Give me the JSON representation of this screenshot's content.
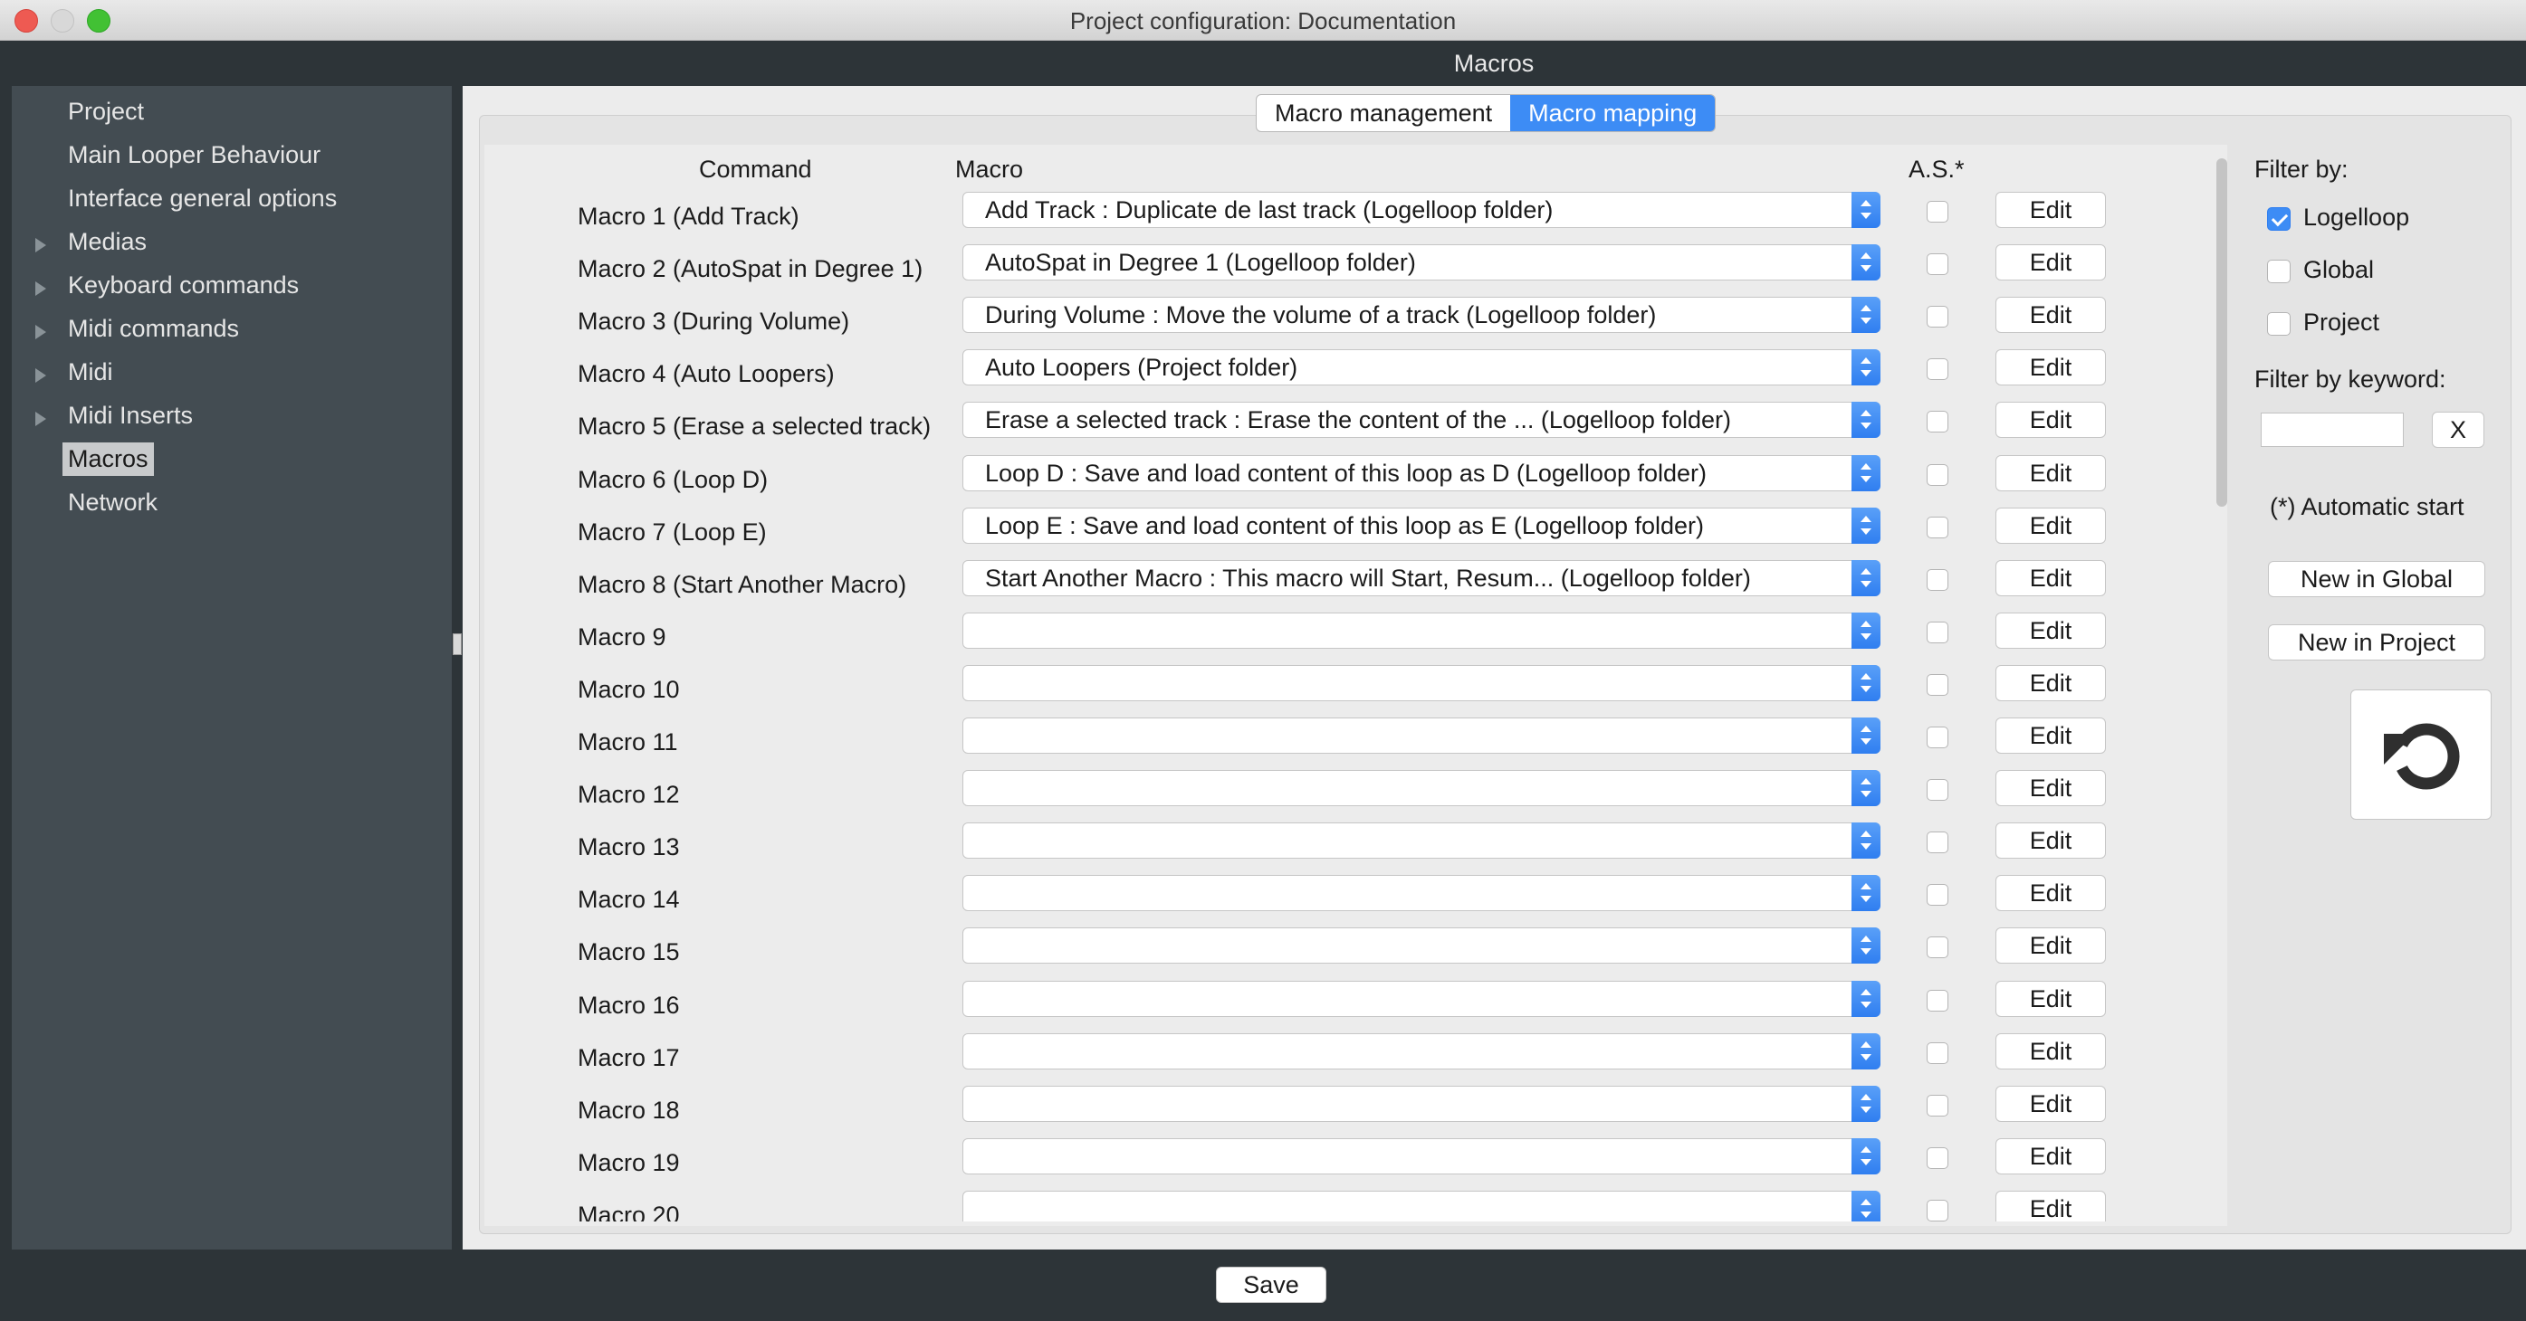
{
  "window": {
    "title": "Project configuration: Documentation"
  },
  "section_title": "Macros",
  "sidebar": {
    "items": [
      {
        "label": "Project",
        "expandable": false,
        "selected": false
      },
      {
        "label": "Main Looper Behaviour",
        "expandable": false,
        "selected": false
      },
      {
        "label": "Interface general options",
        "expandable": false,
        "selected": false
      },
      {
        "label": "Medias",
        "expandable": true,
        "selected": false
      },
      {
        "label": "Keyboard commands",
        "expandable": true,
        "selected": false
      },
      {
        "label": "Midi commands",
        "expandable": true,
        "selected": false
      },
      {
        "label": "Midi",
        "expandable": true,
        "selected": false
      },
      {
        "label": "Midi Inserts",
        "expandable": true,
        "selected": false
      },
      {
        "label": "Macros",
        "expandable": false,
        "selected": true
      },
      {
        "label": "Network",
        "expandable": false,
        "selected": false
      }
    ]
  },
  "tabs": [
    {
      "label": "Macro management",
      "active": false
    },
    {
      "label": "Macro mapping",
      "active": true
    }
  ],
  "table": {
    "headers": {
      "command": "Command",
      "macro": "Macro",
      "autostart": "A.S.*"
    },
    "edit_label": "Edit",
    "rows": [
      {
        "command": "Macro 1 (Add Track)",
        "macro": "Add Track : Duplicate de last track (Logelloop folder)"
      },
      {
        "command": "Macro 2 (AutoSpat in Degree 1)",
        "macro": "AutoSpat in Degree 1 (Logelloop folder)"
      },
      {
        "command": "Macro 3 (During Volume)",
        "macro": "During Volume : Move the volume of a track (Logelloop folder)"
      },
      {
        "command": "Macro 4 (Auto Loopers)",
        "macro": "Auto Loopers (Project folder)"
      },
      {
        "command": "Macro 5 (Erase a selected track)",
        "macro": "Erase a selected track : Erase the content of the ... (Logelloop folder)"
      },
      {
        "command": "Macro 6 (Loop D)",
        "macro": "Loop D : Save and load content of this loop as D (Logelloop folder)"
      },
      {
        "command": "Macro 7 (Loop E)",
        "macro": "Loop E : Save and load content of this loop as E (Logelloop folder)"
      },
      {
        "command": "Macro 8 (Start Another Macro)",
        "macro": "Start Another Macro : This macro will Start, Resum... (Logelloop folder)"
      },
      {
        "command": "Macro 9",
        "macro": ""
      },
      {
        "command": "Macro 10",
        "macro": ""
      },
      {
        "command": "Macro 11",
        "macro": ""
      },
      {
        "command": "Macro 12",
        "macro": ""
      },
      {
        "command": "Macro 13",
        "macro": ""
      },
      {
        "command": "Macro 14",
        "macro": ""
      },
      {
        "command": "Macro 15",
        "macro": ""
      },
      {
        "command": "Macro 16",
        "macro": ""
      },
      {
        "command": "Macro 17",
        "macro": ""
      },
      {
        "command": "Macro 18",
        "macro": ""
      },
      {
        "command": "Macro 19",
        "macro": ""
      },
      {
        "command": "Macro 20",
        "macro": ""
      }
    ]
  },
  "filters": {
    "title": "Filter by:",
    "options": [
      {
        "label": "Logelloop",
        "checked": true
      },
      {
        "label": "Global",
        "checked": false
      },
      {
        "label": "Project",
        "checked": false
      }
    ],
    "keyword_label": "Filter by keyword:",
    "keyword_value": "",
    "clear_label": "X"
  },
  "autostart_note": "(*) Automatic start",
  "buttons": {
    "new_global": "New in Global",
    "new_project": "New in Project",
    "save": "Save"
  },
  "icons": {
    "reset": "refresh-icon"
  },
  "colors": {
    "accent": "#3d8cf5",
    "sidebar_bg": "#434c52",
    "window_bg": "#2d3438"
  }
}
